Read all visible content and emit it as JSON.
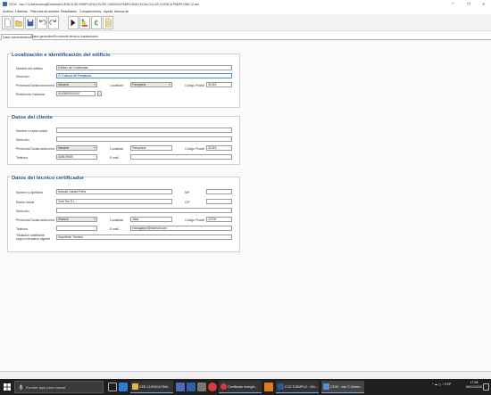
{
  "window": {
    "title": "CE3X - esc C:\\Users\\manugi\\Desktop\\CUENCA DE PAMPLONA 12\\CEE CUENCA PAMPLONA 12\\CALCULOS CUENCA PAMPLONA 12.cex",
    "minimize": "–",
    "maximize": "❐",
    "close": "✕"
  },
  "menu": {
    "items": [
      "Archivo",
      "Librerías",
      "Patrones de sombra",
      "Resultados",
      "Complementos",
      "Ayuda",
      "Acerca de"
    ]
  },
  "toolbar": {
    "icons": [
      "new-document-icon",
      "open-folder-icon",
      "save-icon",
      "undo-icon",
      "redo-icon",
      "calculate-icon",
      "rating-icon",
      "euro-icon",
      "report-icon"
    ]
  },
  "tabs": [
    "Datos administrativos",
    "Datos generales",
    "Envolvente térmica",
    "Instalaciones"
  ],
  "building": {
    "title": "Localización e identificación del edificio",
    "name_label": "Nombre del edificio",
    "name_value": "Edificio de 3 viviendas",
    "address_label": "Dirección",
    "address_value": "C/ Cuenca de Pamplona",
    "province_label": "Provincia/Ciudad autónoma",
    "province_value": "Navarra",
    "locality_label": "Localidad",
    "locality_value": "Pamplona",
    "postal_label": "Código Postal",
    "postal_value": "31015",
    "cadastral_label": "Referencia Catastral",
    "cadastral_value": "3100000000167",
    "cadastral_button": "..."
  },
  "client": {
    "title": "Datos del cliente",
    "name_label": "Nombre o razón social",
    "name_value": "",
    "address_label": "Dirección",
    "address_value": "",
    "province_label": "Provincia/Ciudad autónoma",
    "province_value": "Navarra",
    "locality_label": "Localidad",
    "locality_value": "Pamplona",
    "postal_label": "Código Postal",
    "postal_value": "31015",
    "phone_label": "Teléfono",
    "phone_value": "639479600",
    "email_label": "E-mail",
    "email_value": ""
  },
  "technician": {
    "title": "Datos del técnico certificador",
    "name_label": "Nombre y Apellidos",
    "name_value": "Manuel García Peña",
    "nif_label": "NIF",
    "nif_value": "",
    "company_label": "Razón social",
    "company_value": "Cesi Tec S.L.",
    "cif_label": "CIF",
    "cif_value": "",
    "address_label": "Dirección",
    "address_value": "",
    "province_label": "Provincia/Ciudad autónoma",
    "province_value": "Huesca",
    "locality_label": "Localidad",
    "locality_value": "Jaca",
    "postal_label": "Código Postal",
    "postal_value": "22700",
    "phone_label": "Teléfono",
    "phone_value": "",
    "email_label": "E-mail",
    "email_value": "manugarpe@hotmail.com",
    "qualification_label": "Titulación habilitante según normativa vigente",
    "qualification_value": "Arquitecto Técnico"
  },
  "taskbar": {
    "search_placeholder": "Escribe aquí para buscar",
    "tasks": [
      {
        "label": "CEE CUENCA PAM...",
        "color": "#e0b84a"
      },
      {
        "label": "Certificado energét...",
        "color": "#d83b3b"
      },
      {
        "label": "CCE EJEMPLO - Wo...",
        "color": "#2b5797"
      },
      {
        "label": "CE3X - esc C:\\Users...",
        "color": "#5a8fd8"
      }
    ],
    "tray": "^ ☁ ◻ ♪ ESP",
    "time": "17:58",
    "date": "06/01/2018"
  }
}
